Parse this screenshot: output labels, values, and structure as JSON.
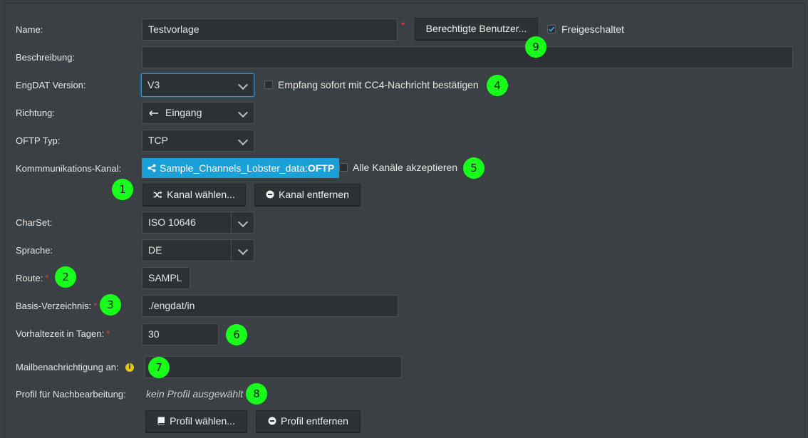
{
  "form": {
    "name_label": "Name:",
    "name_value": "Testvorlage",
    "authorized_users_button": "Berechtigte Benutzer...",
    "enabled_label": "Freigeschaltet",
    "description_label": "Beschreibung:",
    "description_value": "",
    "engdat_version_label": "EngDAT Version:",
    "engdat_version_value": "V3",
    "cc4_confirm_label": "Empfang sofort mit CC4-Nachricht bestätigen",
    "direction_label": "Richtung:",
    "direction_value": "Eingang",
    "oftp_type_label": "OFTP Typ:",
    "oftp_type_value": "TCP",
    "channel_label": "Kommmunikations-Kanal:",
    "channel_name": "Sample_Channels_Lobster_data",
    "channel_separator": ":",
    "channel_type": "OFTP",
    "accept_all_channels_label": "Alle Kanäle akzeptieren",
    "choose_channel_button": "Kanal wählen...",
    "remove_channel_button": "Kanal entfernen",
    "charset_label": "CharSet:",
    "charset_value": "ISO 10646",
    "language_label": "Sprache:",
    "language_value": "DE",
    "route_label": "Route:",
    "route_value": "SAMPL",
    "base_dir_label": "Basis-Verzeichnis:",
    "base_dir_value": "./engdat/in",
    "retention_label": "Vorhaltezeit in Tagen:",
    "retention_value": "30",
    "mail_label": "Mailbenachrichtigung an:",
    "mail_value": "",
    "profile_label": "Profil für Nachbearbeitung:",
    "profile_value": "kein Profil ausgewählt",
    "choose_profile_button": "Profil wählen...",
    "remove_profile_button": "Profil entfernen",
    "required_mark": "*",
    "info_icon_glyph": "i"
  },
  "checkboxes": {
    "enabled_checked": true,
    "cc4_confirm_checked": false,
    "accept_all_channels_checked": false
  },
  "markers": [
    "1",
    "2",
    "3",
    "4",
    "5",
    "6",
    "7",
    "8",
    "9"
  ],
  "colors": {
    "marker": "#17ff1a",
    "channel_badge": "#1aa0d6",
    "required": "#e0433f",
    "info_icon": "#e6c619"
  }
}
